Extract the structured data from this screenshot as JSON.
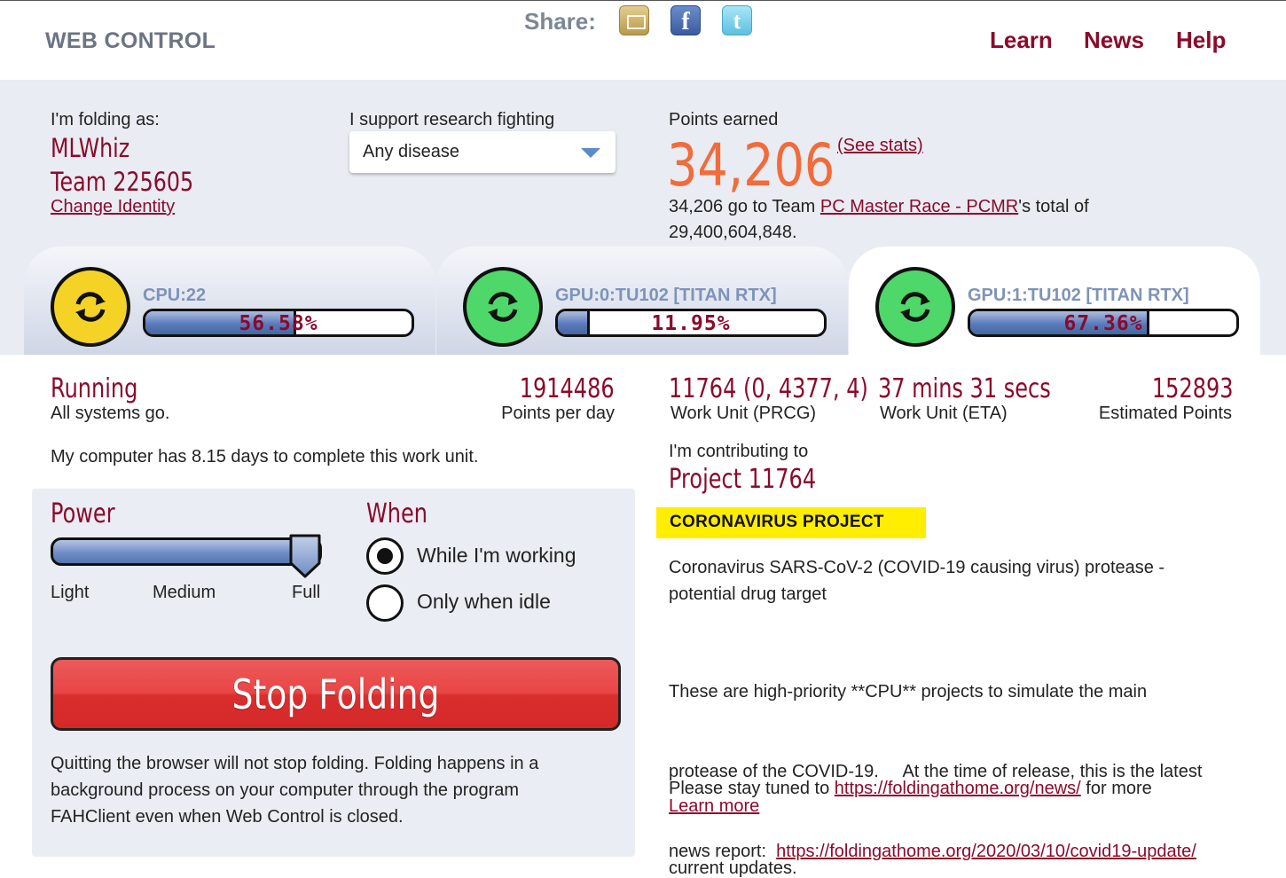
{
  "header": {
    "brand": "WEB CONTROL",
    "share_label": "Share:",
    "share_icons": [
      "email-icon",
      "facebook-icon",
      "twitter-icon"
    ],
    "nav": [
      "Learn",
      "News",
      "Help"
    ]
  },
  "identity": {
    "label": "I'm folding as:",
    "user": "MLWhiz",
    "team": "Team 225605",
    "change": "Change Identity"
  },
  "research": {
    "label": "I support research fighting",
    "selected": "Any disease"
  },
  "points": {
    "label": "Points earned",
    "value": "34,206",
    "see_stats": "(See stats)",
    "team_prefix": "34,206 go to Team ",
    "team_link": "PC Master Race - PCMR",
    "team_suffix": "'s total of",
    "team_total": "29,400,604,848."
  },
  "slots": [
    {
      "name": "CPU:22",
      "progress": "56.58%",
      "fill": 0.5658,
      "color": "#f5d326"
    },
    {
      "name": "GPU:0:TU102 [TITAN RTX]",
      "progress": "11.95%",
      "fill": 0.1195,
      "color": "#4fd86a"
    },
    {
      "name": "GPU:1:TU102 [TITAN RTX]",
      "progress": "67.36%",
      "fill": 0.6736,
      "color": "#4fd86a"
    }
  ],
  "status": {
    "state": "Running",
    "message": "All systems go.",
    "ppd": "1914486",
    "ppd_label": "Points per day",
    "days_text": "My computer has 8.15 days to complete this work unit."
  },
  "work_unit": {
    "prcg": "11764 (0, 4377, 4)",
    "prcg_label": "Work Unit (PRCG)",
    "eta": "37 mins 31 secs",
    "eta_label": "Work Unit (ETA)",
    "est_points": "152893",
    "est_label": "Estimated Points"
  },
  "project": {
    "contrib_label": "I'm contributing to",
    "name": "Project 11764",
    "tag": "CORONAVIRUS PROJECT",
    "desc1": "Coronavirus SARS-CoV-2 (COVID-19 causing virus) protease -",
    "desc2": "potential drug target",
    "p2_line1": "These are high-priority **CPU** projects to simulate the main",
    "p2_line2": "protease of the COVID-19.     At the time of release, this is the latest",
    "p2_line3": "news report:  ",
    "p2_link": "https://foldingathome.org/2020/03/10/covid19-update/",
    "p3_prefix": "Please stay tuned to ",
    "p3_link": "https://foldingathome.org/news/",
    "p3_suffix": " for more",
    "p3_line2": "current updates.",
    "learn_more": "Learn more"
  },
  "power": {
    "title": "Power",
    "levels": [
      "Light",
      "Medium",
      "Full"
    ],
    "selected": "Full"
  },
  "when": {
    "title": "When",
    "options": [
      "While I'm working",
      "Only when idle"
    ],
    "selected": "While I'm working"
  },
  "stop": {
    "label": "Stop Folding",
    "note1": "Quitting the browser will not stop folding. Folding happens in a",
    "note2": "background process on your computer through the program",
    "note3": "FAHClient even when Web Control is closed."
  }
}
